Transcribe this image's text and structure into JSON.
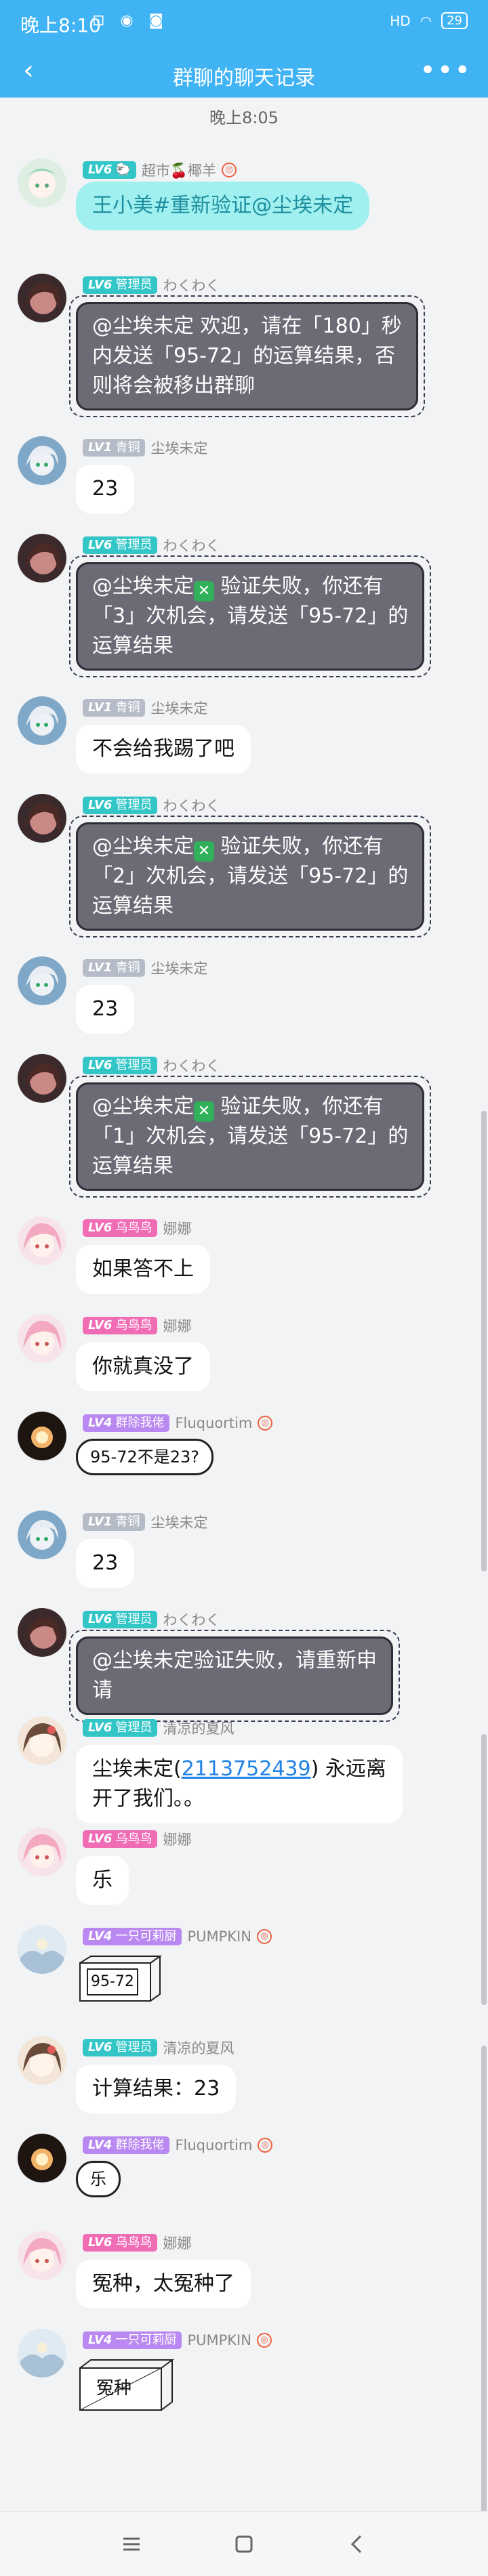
{
  "status": {
    "time": "晚上8:10",
    "icons": "⊡ ◉ ◙",
    "network": "HD",
    "battery": "29"
  },
  "header": {
    "title": "群聊的聊天记录",
    "back": "‹",
    "more": "•••"
  },
  "timestamp": "晚上8:05",
  "messages": [
    {
      "badge": "超市",
      "lv": "LV6",
      "name": "超市🍒椰羊",
      "text": "王小美#重新验证@尘埃未定"
    },
    {
      "badge": "管理员",
      "lv": "LV6",
      "name": "わくわく",
      "lines": [
        "@尘埃未定 欢迎，请在「180」秒",
        "内发送「95-72」的运算结果，否",
        "则将会被移出群聊"
      ]
    },
    {
      "badge": "青铜",
      "lv": "LV1",
      "name": "尘埃未定",
      "text": "23"
    },
    {
      "badge": "管理员",
      "lv": "LV6",
      "name": "わくわく",
      "prefix": "@尘埃未定",
      "lines": [
        "验证失败，你还有",
        "「3」次机会，请发送「95-72」的",
        "运算结果"
      ]
    },
    {
      "badge": "青铜",
      "lv": "LV1",
      "name": "尘埃未定",
      "text": "不会给我踢了吧"
    },
    {
      "badge": "管理员",
      "lv": "LV6",
      "name": "わくわく",
      "prefix": "@尘埃未定",
      "lines": [
        "验证失败，你还有",
        "「2」次机会，请发送「95-72」的",
        "运算结果"
      ]
    },
    {
      "badge": "青铜",
      "lv": "LV1",
      "name": "尘埃未定",
      "text": "23"
    },
    {
      "badge": "管理员",
      "lv": "LV6",
      "name": "わくわく",
      "prefix": "@尘埃未定",
      "lines": [
        "验证失败，你还有",
        "「1」次机会，请发送「95-72」的",
        "运算结果"
      ]
    },
    {
      "badge": "乌鸟鸟",
      "lv": "LV6",
      "name": "娜娜",
      "text": "如果答不上"
    },
    {
      "badge": "乌鸟鸟",
      "lv": "LV6",
      "name": "娜娜",
      "text": "你就真没了"
    },
    {
      "badge": "群除我佬",
      "lv": "LV4",
      "name": "Fluquortim",
      "text": "95-72不是23?"
    },
    {
      "badge": "青铜",
      "lv": "LV1",
      "name": "尘埃未定",
      "text": "23"
    },
    {
      "badge": "管理员",
      "lv": "LV6",
      "name": "わくわく",
      "lines": [
        "@尘埃未定验证失败，请重新申",
        "请"
      ]
    },
    {
      "badge": "管理员",
      "lv": "LV6",
      "name": "清凉的夏风",
      "line1_pre": "尘埃未定(",
      "line1_link": "2113752439",
      "line1_post": ") 永远离",
      "line2": "开了我们。。"
    },
    {
      "badge": "乌鸟鸟",
      "lv": "LV6",
      "name": "娜娜",
      "text": "乐"
    },
    {
      "badge": "一只可莉厨",
      "lv": "LV4",
      "name": "PUMPKIN",
      "text": "95-72"
    },
    {
      "badge": "管理员",
      "lv": "LV6",
      "name": "清凉的夏风",
      "text": "计算结果：23"
    },
    {
      "badge": "群除我佬",
      "lv": "LV4",
      "name": "Fluquortim",
      "text": "乐"
    },
    {
      "badge": "乌鸟鸟",
      "lv": "LV6",
      "name": "娜娜",
      "text": "冤种，太冤种了"
    },
    {
      "badge": "一只可莉厨",
      "lv": "LV4",
      "name": "PUMPKIN",
      "text": "冤种"
    }
  ],
  "nav": {
    "menu": "≡",
    "home": "□",
    "back": "‹"
  },
  "colors": {
    "header": "#3fb3f3",
    "admin_badge": "#34c6c7",
    "link": "#2183e6"
  }
}
